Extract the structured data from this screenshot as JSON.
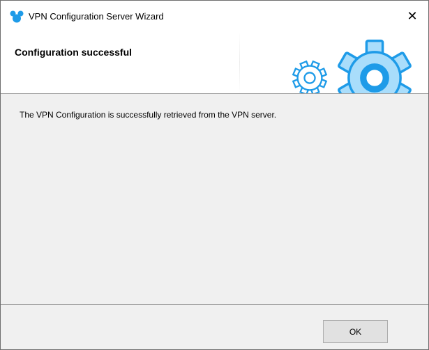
{
  "window": {
    "title": "VPN Configuration Server Wizard",
    "app_icon": "mickey-mouse-icon",
    "close_icon": "close-icon",
    "close_glyph": "✕"
  },
  "header": {
    "title": "Configuration successful",
    "icons": [
      "gear-icon",
      "gear-icon"
    ],
    "gear_color": "#1E9BE8",
    "gear_fill": "#A9DDFB"
  },
  "content": {
    "message": "The VPN Configuration is successfully retrieved from the VPN server."
  },
  "footer": {
    "ok_label": "OK"
  }
}
